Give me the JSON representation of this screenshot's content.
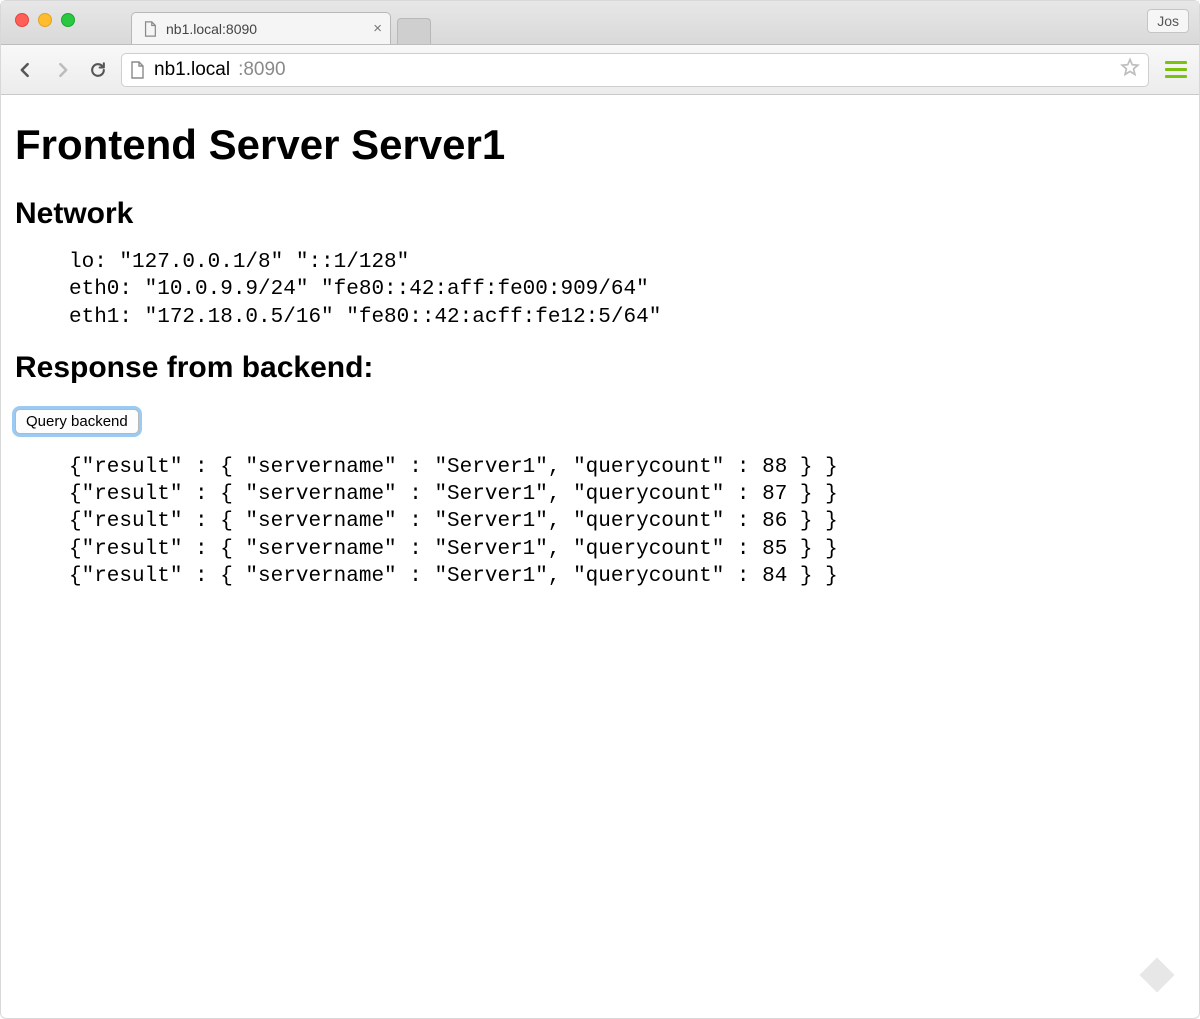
{
  "chrome": {
    "tab_title": "nb1.local:8090",
    "user_chip": "Jos",
    "url_host": "nb1.local",
    "url_port": ":8090"
  },
  "page": {
    "h1": "Frontend Server Server1",
    "network_heading": "Network",
    "network_lines": [
      "lo: \"127.0.0.1/8\" \"::1/128\"",
      "eth0: \"10.0.9.9/24\" \"fe80::42:aff:fe00:909/64\"",
      "eth1: \"172.18.0.5/16\" \"fe80::42:acff:fe12:5/64\""
    ],
    "response_heading": "Response from backend:",
    "query_button": "Query backend",
    "responses": [
      "{\"result\" : { \"servername\" : \"Server1\", \"querycount\" : 88 } }",
      "{\"result\" : { \"servername\" : \"Server1\", \"querycount\" : 87 } }",
      "{\"result\" : { \"servername\" : \"Server1\", \"querycount\" : 86 } }",
      "{\"result\" : { \"servername\" : \"Server1\", \"querycount\" : 85 } }",
      "{\"result\" : { \"servername\" : \"Server1\", \"querycount\" : 84 } }"
    ]
  }
}
